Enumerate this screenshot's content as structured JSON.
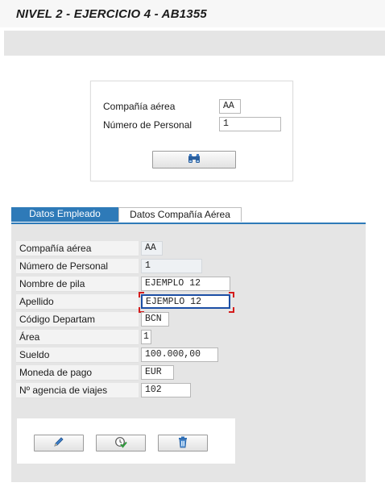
{
  "window": {
    "title": "NIVEL 2 - EJERCICIO 4 - AB1355"
  },
  "search": {
    "airline_label": "Compañía aérea",
    "airline_value": "AA",
    "personnel_label": "Número de Personal",
    "personnel_value": "1",
    "search_button_icon": "binoculars-icon"
  },
  "tabs": [
    {
      "label": "Datos Empleado",
      "active": true
    },
    {
      "label": "Datos Compañía Aérea",
      "active": false
    }
  ],
  "employee": {
    "fields": [
      {
        "label": "Compañía aérea",
        "value": "AA",
        "readonly": true
      },
      {
        "label": "Número de Personal",
        "value": "1",
        "readonly": true
      },
      {
        "label": "Nombre de pila",
        "value": "EJEMPLO 12",
        "readonly": false
      },
      {
        "label": "Apellido",
        "value": "EJEMPLO 12",
        "readonly": false,
        "focused": true
      },
      {
        "label": "Código Departam",
        "value": "BCN",
        "readonly": false
      },
      {
        "label": "Área",
        "value": "1",
        "readonly": false
      },
      {
        "label": "Sueldo",
        "value": "100.000,00",
        "readonly": false
      },
      {
        "label": "Moneda de pago",
        "value": "EUR",
        "readonly": false
      },
      {
        "label": "Nº agencia de viajes",
        "value": "102",
        "readonly": false
      }
    ]
  },
  "actions": [
    {
      "icon": "pencil-icon",
      "name": "edit"
    },
    {
      "icon": "clock-check-icon",
      "name": "save"
    },
    {
      "icon": "trash-icon",
      "name": "delete"
    }
  ],
  "colors": {
    "accent": "#2e7ab8",
    "panel": "#e5e5e5",
    "focus_corner": "#d41b1b"
  }
}
